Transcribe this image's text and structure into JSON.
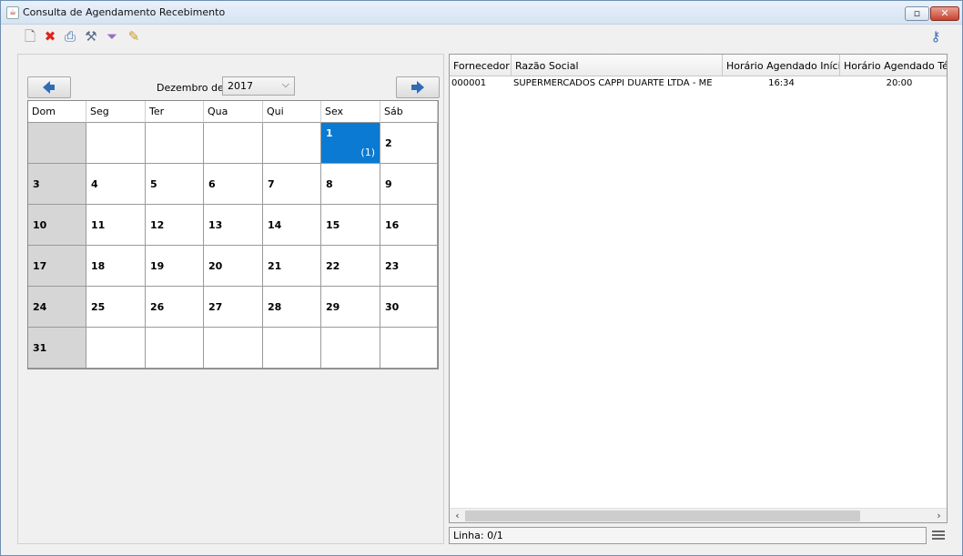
{
  "window": {
    "title": "Consulta de Agendamento Recebimento"
  },
  "toolbar": {
    "icons": [
      "new-document-icon",
      "delete-icon",
      "print-icon",
      "tools-icon",
      "filter-icon",
      "edit-icon"
    ],
    "key_icon": "key-icon"
  },
  "calendar": {
    "month_label": "Dezembro de",
    "year": "2017",
    "weekdays": [
      "Dom",
      "Seg",
      "Ter",
      "Qua",
      "Qui",
      "Sex",
      "Sáb"
    ],
    "weeks": [
      [
        "",
        "",
        "",
        "",
        "",
        "1",
        "2"
      ],
      [
        "3",
        "4",
        "5",
        "6",
        "7",
        "8",
        "9"
      ],
      [
        "10",
        "11",
        "12",
        "13",
        "14",
        "15",
        "16"
      ],
      [
        "17",
        "18",
        "19",
        "20",
        "21",
        "22",
        "23"
      ],
      [
        "24",
        "25",
        "26",
        "27",
        "28",
        "29",
        "30"
      ],
      [
        "31",
        "",
        "",
        "",
        "",
        "",
        ""
      ]
    ],
    "selected_day": "1",
    "selected_count": "(1)",
    "selected_color": "#0a7ad2"
  },
  "grid": {
    "columns": [
      "Fornecedor",
      "Razão Social",
      "Horário Agendado Início",
      "Horário Agendado Término"
    ],
    "rows": [
      [
        "000001",
        "SUPERMERCADOS CAPPI DUARTE LTDA - ME",
        "16:34",
        "20:00"
      ]
    ]
  },
  "status": {
    "line_text": "Linha: 0/1"
  }
}
